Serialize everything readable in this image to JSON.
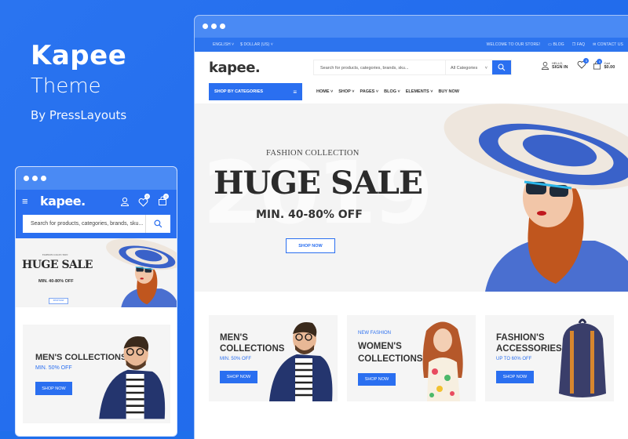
{
  "promo": {
    "title": "Kapee",
    "subtitle": "Theme",
    "byline": "By PressLayouts"
  },
  "colors": {
    "brand_blue": "#2a6ff0",
    "window_bar": "#4a8af4",
    "background": "#1f6feb"
  },
  "desktop": {
    "topbar": {
      "language": "ENGLISH",
      "currency": "$ DOLLAR (US)",
      "welcome": "WELCOME TO OUR STORE!",
      "links": [
        {
          "icon": "blog-icon",
          "label": "BLOG"
        },
        {
          "icon": "faq-icon",
          "label": "FAQ"
        },
        {
          "icon": "mail-icon",
          "label": "CONTACT US"
        }
      ]
    },
    "header": {
      "logo": "kapee.",
      "search_placeholder": "Search for products, categories, brands, sku...",
      "category_select": "All Categories",
      "account_hello": "HELLO,",
      "account_signin": "SIGN IN",
      "wishlist_count": "0",
      "cart_count": "0",
      "cart_label": "Cart",
      "cart_total": "$0.00"
    },
    "nav": {
      "shop_by_categories": "SHOP BY CATEGORIES",
      "items": [
        {
          "label": "HOME",
          "dropdown": true
        },
        {
          "label": "SHOP",
          "dropdown": true
        },
        {
          "label": "PAGES",
          "dropdown": true
        },
        {
          "label": "BLOG",
          "dropdown": true
        },
        {
          "label": "ELEMENTS",
          "dropdown": true
        },
        {
          "label": "BUY NOW",
          "dropdown": false
        }
      ]
    },
    "hero": {
      "watermark": "2019",
      "subtitle": "FASHION COLLECTION",
      "title": "HUGE SALE",
      "offer": "MIN. 40-80% OFF",
      "button": "SHOP NOW"
    },
    "banners": [
      {
        "tag": "",
        "title_line1": "MEN'S",
        "title_line2": "COLLECTIONS",
        "discount": "MIN. 50% OFF",
        "button": "SHOP NOW"
      },
      {
        "tag": "NEW FASHION",
        "title_line1": "WOMEN'S",
        "title_line2": "COLLECTIONS",
        "discount": "",
        "button": "SHOP NOW"
      },
      {
        "tag": "",
        "title_line1": "FASHION'S",
        "title_line2": "ACCESSORIES",
        "discount": "UP TO 60% OFF",
        "button": "SHOP NOW"
      }
    ]
  },
  "mobile": {
    "logo": "kapee.",
    "wishlist_count": "0",
    "cart_count": "0",
    "search_placeholder": "Search for products, categories, brands, sku...",
    "hero": {
      "subtitle": "FASHION COLLECTION",
      "title": "HUGE SALE",
      "offer": "MIN. 40-80% OFF",
      "button": "SHOP NOW"
    },
    "banner": {
      "title": "MEN'S COLLECTIONS",
      "discount": "MIN. 50% OFF",
      "button": "SHOP NOW"
    }
  }
}
